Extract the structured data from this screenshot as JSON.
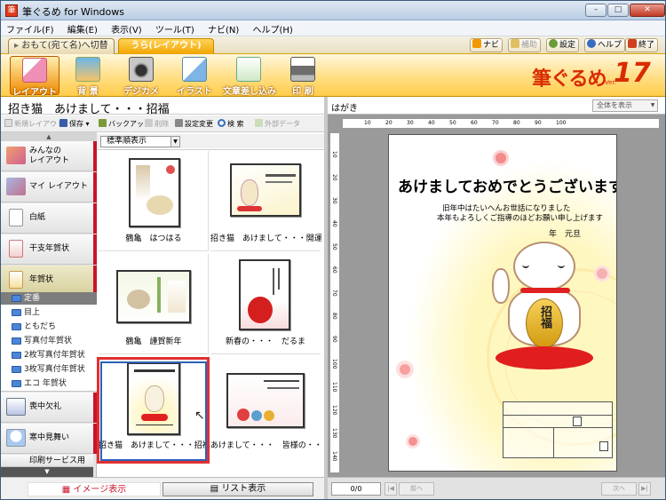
{
  "window": {
    "title": "筆ぐるめ for Windows",
    "app_icon": "筆",
    "min": "–",
    "max": "□",
    "close": "✕"
  },
  "menu": [
    "ファイル(F)",
    "編集(E)",
    "表示(V)",
    "ツール(T)",
    "ナビ(N)",
    "ヘルプ(H)"
  ],
  "modetabs": {
    "front": "おもて(宛て名)へ切替",
    "back": "うら(レイアウト)"
  },
  "topbuttons": {
    "navi": "ナビ",
    "assist": "補助",
    "settings": "設定",
    "help": "ヘルプ",
    "exit": "終了"
  },
  "toolbar": [
    {
      "label": "レイアウト",
      "icon": "layout-icon"
    },
    {
      "label": "背 景",
      "icon": "background-icon"
    },
    {
      "label": "デジカメ",
      "icon": "camera-icon"
    },
    {
      "label": "イラスト",
      "icon": "illustration-icon"
    },
    {
      "label": "文章差し込み",
      "icon": "text-insert-icon"
    },
    {
      "label": "印 刷",
      "icon": "printer-icon"
    }
  ],
  "logo": {
    "text": "筆ぐるめ",
    "version": "17",
    "ver_label": "Ver."
  },
  "left": {
    "title": "招き猫　あけまして・・・招福",
    "actions": {
      "new_layout": "新規レイアウト",
      "save": "保存",
      "backup": "バックアップ",
      "delete": "削除",
      "settings_change": "設定変更",
      "search": "検 索",
      "external": "外部データ"
    },
    "categories": [
      "みんなの\nレイアウト",
      "マイ レイアウト",
      "白紙",
      "干支年賀状",
      "年賀状",
      "喪中欠礼",
      "寒中見舞い",
      "印刷サービス用"
    ],
    "subfolders": [
      "定番",
      "目上",
      "ともだち",
      "写真付年賀状",
      "2枚写真付年賀状",
      "3枚写真付年賀状",
      "エコ 年賀状"
    ],
    "sort": "標準順表示",
    "thumbnails": [
      {
        "caption": "鶴亀　はつはる"
      },
      {
        "caption": "招き猫　あけまして・・・開運"
      },
      {
        "caption": "鶴亀　謹賀新年"
      },
      {
        "caption": "新春の・・・　だるま"
      },
      {
        "caption": "招き猫　あけまして・・・招福"
      },
      {
        "caption": "あけまして・・・　皆様の・・・"
      }
    ],
    "view_buttons": {
      "image": "イメージ表示",
      "list": "リスト表示"
    }
  },
  "right": {
    "label": "はがき",
    "zoom": "全体を表示",
    "ruler_marks": [
      "10",
      "20",
      "30",
      "40",
      "50",
      "60",
      "70",
      "80",
      "90",
      "100"
    ],
    "ruler_left_marks": [
      "10",
      "20",
      "30",
      "40",
      "50",
      "60",
      "70",
      "80",
      "90",
      "100",
      "110",
      "120",
      "130",
      "140"
    ],
    "postcard": {
      "greeting": "あけましておめでとうございます",
      "body1": "旧年中はたいへんお世話になりました",
      "body2": "本年もよろしくご指導のほどお願い申し上げます",
      "date": "年　元旦",
      "charm": "招福"
    },
    "page_counter": "0/0",
    "prev": "前へ",
    "next": "次へ"
  },
  "colors": {
    "accent": "#f2a400",
    "red": "#c8142a",
    "logo": "#d92b00",
    "select_blue": "#2a62b8"
  }
}
